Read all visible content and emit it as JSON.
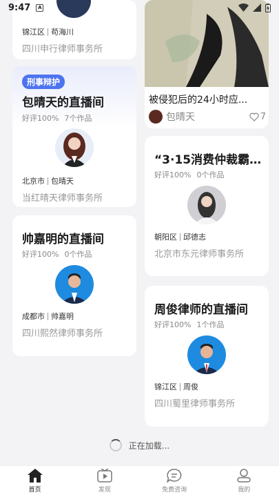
{
  "status_bar": {
    "time": "9:47",
    "notif_glyph": "A"
  },
  "cards": {
    "c1": {
      "location": {
        "city": "锦江区",
        "name": "苟海川"
      },
      "firm": "四川申行律师事务所"
    },
    "c2": {
      "tag": "刑事辩护",
      "title": "包晴天的直播间",
      "rating": "好评100%",
      "works": "7个作品",
      "location": {
        "city": "北京市",
        "name": "包晴天"
      },
      "firm": "当红晴天律师事务所"
    },
    "c3": {
      "title": "帅嘉明的直播间",
      "rating": "好评100%",
      "works": "0个作品",
      "location": {
        "city": "成都市",
        "name": "帅嘉明"
      },
      "firm": "四川熙然律师事务所"
    },
    "video": {
      "title": "被侵犯后的24小时应...",
      "author": "包晴天",
      "likes": "7"
    },
    "c4": {
      "title": "“3·15消费仲裁霸...",
      "rating": "好评100%",
      "works": "0个作品",
      "location": {
        "city": "朝阳区",
        "name": "邱德志"
      },
      "firm": "北京市东元律师事务所"
    },
    "c5": {
      "title": "周俊律师的直播间",
      "rating": "好评100%",
      "works": "1个作品",
      "location": {
        "city": "锦江区",
        "name": "周俊"
      },
      "firm": "四川蜀里律师事务所"
    }
  },
  "loading_text": "正在加载...",
  "tabs": [
    {
      "label": "首页",
      "icon": "home-icon"
    },
    {
      "label": "发现",
      "icon": "video-icon"
    },
    {
      "label": "免费咨询",
      "icon": "chat-icon"
    },
    {
      "label": "我的",
      "icon": "user-icon"
    }
  ]
}
